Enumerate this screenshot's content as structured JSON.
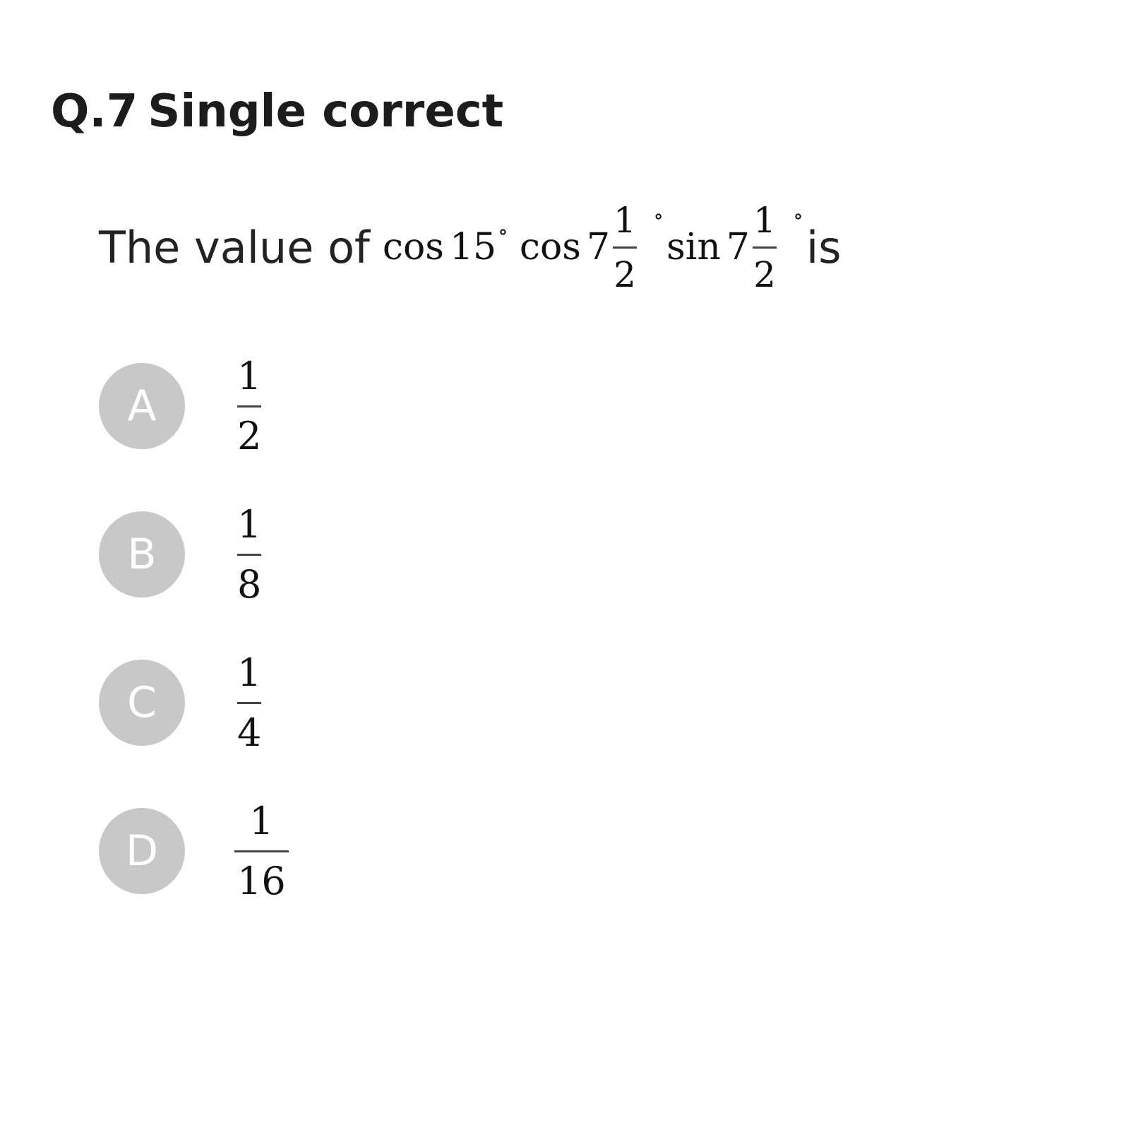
{
  "question": {
    "number_label": "Q.7",
    "type_label": "Single correct",
    "prefix_text": "The value of",
    "expression": {
      "term1_func": "cos",
      "term1_arg": "15",
      "term2_func": "cos",
      "term2_whole": "7",
      "term2_num": "1",
      "term2_den": "2",
      "term3_func": "sin",
      "term3_whole": "7",
      "term3_num": "1",
      "term3_den": "2",
      "degree_symbol": "∘"
    },
    "suffix_text": "is"
  },
  "options": [
    {
      "letter": "A",
      "numerator": "1",
      "denominator": "2"
    },
    {
      "letter": "B",
      "numerator": "1",
      "denominator": "8"
    },
    {
      "letter": "C",
      "numerator": "1",
      "denominator": "4"
    },
    {
      "letter": "D",
      "numerator": "1",
      "denominator": "16"
    }
  ],
  "colors": {
    "badge_background": "#c8c8c8",
    "badge_text": "#ffffff",
    "text": "#1a1a1a"
  }
}
